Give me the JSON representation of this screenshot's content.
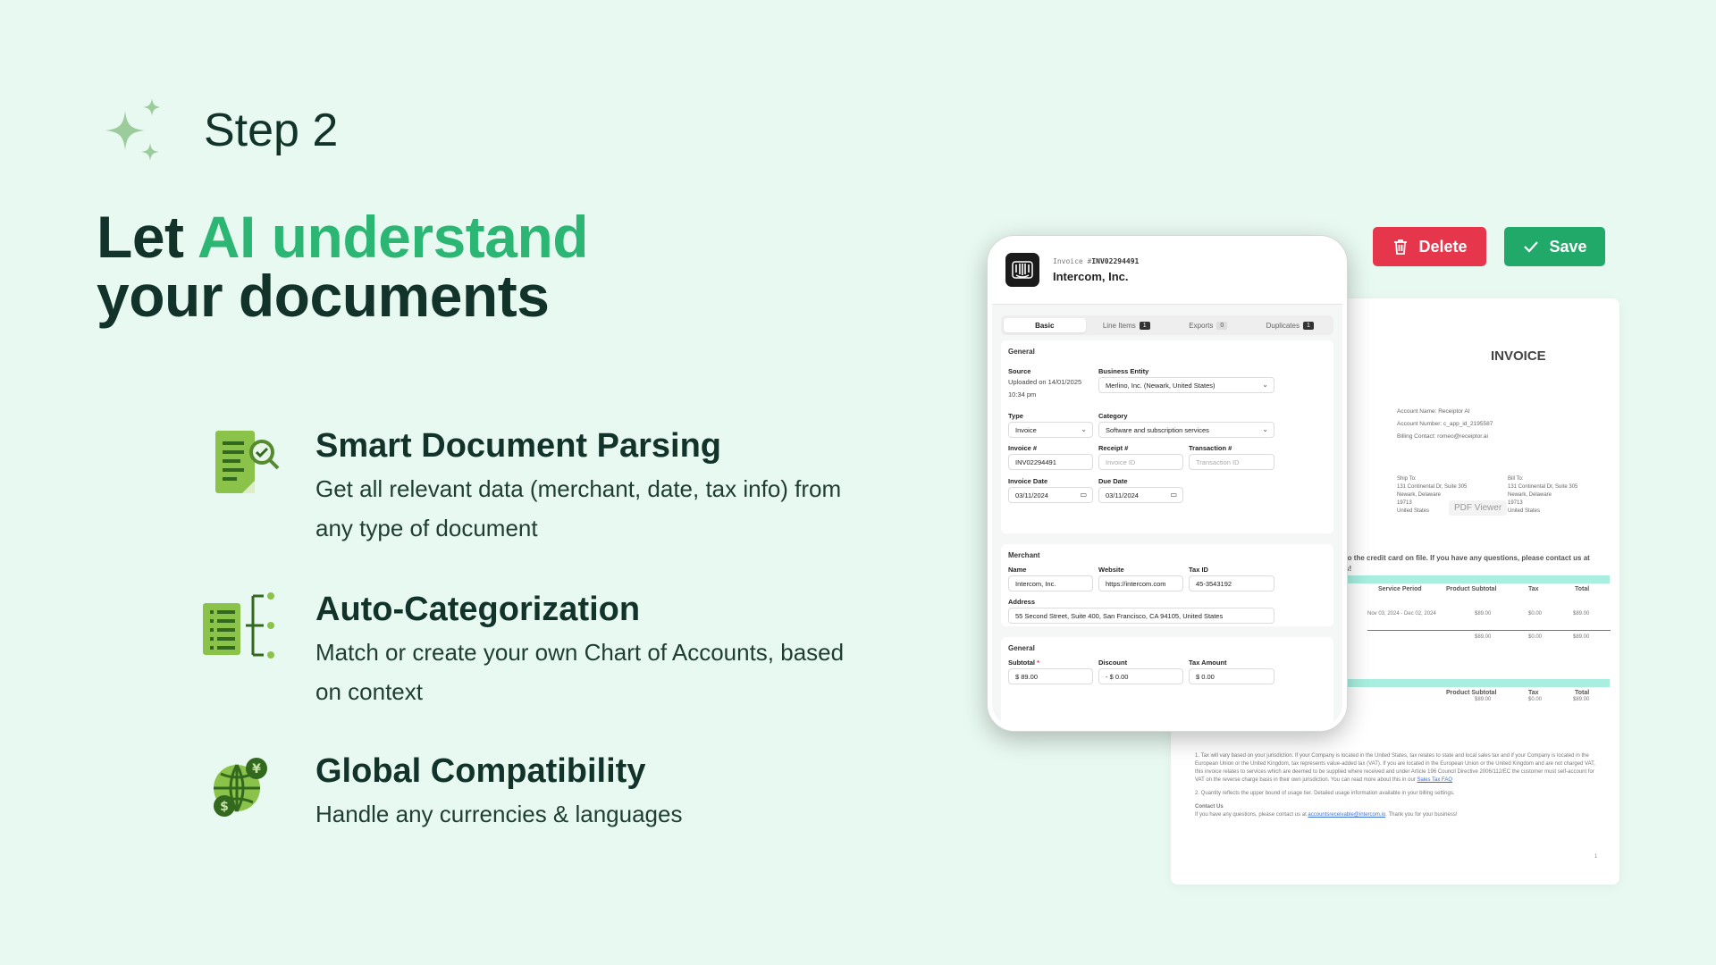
{
  "step": {
    "label": "Step 2"
  },
  "headline": {
    "line1_plain": "Let ",
    "line1_accent": "AI understand",
    "line2": "your documents"
  },
  "features": [
    {
      "icon": "document-search-icon",
      "title": "Smart Document Parsing",
      "desc": "Get all relevant data (merchant, date, tax info) from any type of document"
    },
    {
      "icon": "categorize-list-icon",
      "title": "Auto-Categorization",
      "desc": "Match or create your own Chart of Accounts, based on context"
    },
    {
      "icon": "globe-currency-icon",
      "title": "Global Compatibility",
      "desc": "Handle any currencies & languages"
    }
  ],
  "actions": {
    "delete_label": "Delete",
    "save_label": "Save"
  },
  "invoice_preview": {
    "title": "INVOICE",
    "meta": [
      "Account Name: Receiptor AI",
      "Account Number: c_app_id_2195587",
      "Billing Contact: romeo@receiptor.ai"
    ],
    "ship_to": [
      "Ship To:",
      "131 Continental Dr, Suite 305",
      "Newark, Delaware",
      "19713",
      "United States"
    ],
    "bill_to": [
      "Bill To:",
      "131 Continental Dr, Suite 305",
      "Newark, Delaware",
      "19713",
      "United States"
    ],
    "pdf_viewer": "PDF Viewer",
    "charge_line1": "to the credit card on file. If you have any questions, please contact us at",
    "charge_line2": "s!",
    "table1_headers": [
      "Service Period",
      "Product Subtotal",
      "Tax",
      "Total"
    ],
    "table1_row": [
      "Nov 03, 2024 - Dec 02, 2024",
      "$89.00",
      "$0.00",
      "$89.00"
    ],
    "table1_total": [
      "$89.00",
      "$0.00",
      "$89.00"
    ],
    "table2_headers": [
      "Product Subtotal",
      "Tax",
      "Total"
    ],
    "table2_row": [
      "$89.00",
      "$0.00",
      "$89.00"
    ],
    "note1": "1. Tax will vary based on your jurisdiction. If your Company is located in the United States, tax relates to state and local sales tax and if your Company is located in the European Union or the United Kingdom, tax represents value-added tax (VAT). If you are located in the European Union or the United Kingdom and are not charged VAT, this invoice relates to services which are deemed to be supplied where received and under Article 196 Council Directive 2006/112/EC the customer must self-account for VAT on the reverse charge basis in their own jurisdiction. You can read more about this in our",
    "note1_link": "Sales Tax FAQ",
    "note2": "2. Quantity reflects the upper bound of usage tier. Detailed usage information available in your billing settings.",
    "contact_title": "Contact Us",
    "contact_text": "If you have any questions, please contact us at",
    "contact_link": "accountsreceivable@intercom.io",
    "contact_end": ". Thank you for your business!",
    "page_number": "1"
  },
  "phone": {
    "invoice_prefix": "Invoice #",
    "invoice_number": "INV02294491",
    "company": "Intercom, Inc.",
    "tabs": [
      {
        "label": "Basic",
        "badge": ""
      },
      {
        "label": "Line Items",
        "badge": "1"
      },
      {
        "label": "Exports",
        "badge": "0"
      },
      {
        "label": "Duplicates",
        "badge": "1"
      }
    ],
    "general_title": "General",
    "source_label": "Source",
    "source_value": "Uploaded on 14/01/2025 10:34 pm",
    "business_entity_label": "Business Entity",
    "business_entity_value": "Merlino, Inc. (Newark, United States)",
    "type_label": "Type",
    "type_value": "Invoice",
    "category_label": "Category",
    "category_value": "Software and subscription services",
    "invoice_no_label": "Invoice #",
    "invoice_no_value": "INV02294491",
    "receipt_label": "Receipt #",
    "receipt_placeholder": "Invoice ID",
    "transaction_label": "Transaction #",
    "transaction_placeholder": "Transaction ID",
    "invoice_date_label": "Invoice Date",
    "invoice_date_value": "03/11/2024",
    "due_date_label": "Due Date",
    "due_date_value": "03/11/2024",
    "merchant_title": "Merchant",
    "name_label": "Name",
    "name_value": "Intercom, Inc.",
    "website_label": "Website",
    "website_value": "https://intercom.com",
    "taxid_label": "Tax ID",
    "taxid_value": "45-3543192",
    "address_label": "Address",
    "address_value": "55 Second Street, Suite 400, San Francisco, CA 94105, United States",
    "general2_title": "General",
    "subtotal_label": "Subtotal",
    "subtotal_required": "*",
    "subtotal_value": "$ 89.00",
    "discount_label": "Discount",
    "discount_value": "- $ 0.00",
    "taxamount_label": "Tax Amount",
    "taxamount_value": "$ 0.00"
  },
  "colors": {
    "background": "#e8f9f1",
    "accent": "#2bb673",
    "text": "#12332a",
    "delete": "#e5364b",
    "save": "#21a96a",
    "icon_green": "#7cb342"
  }
}
